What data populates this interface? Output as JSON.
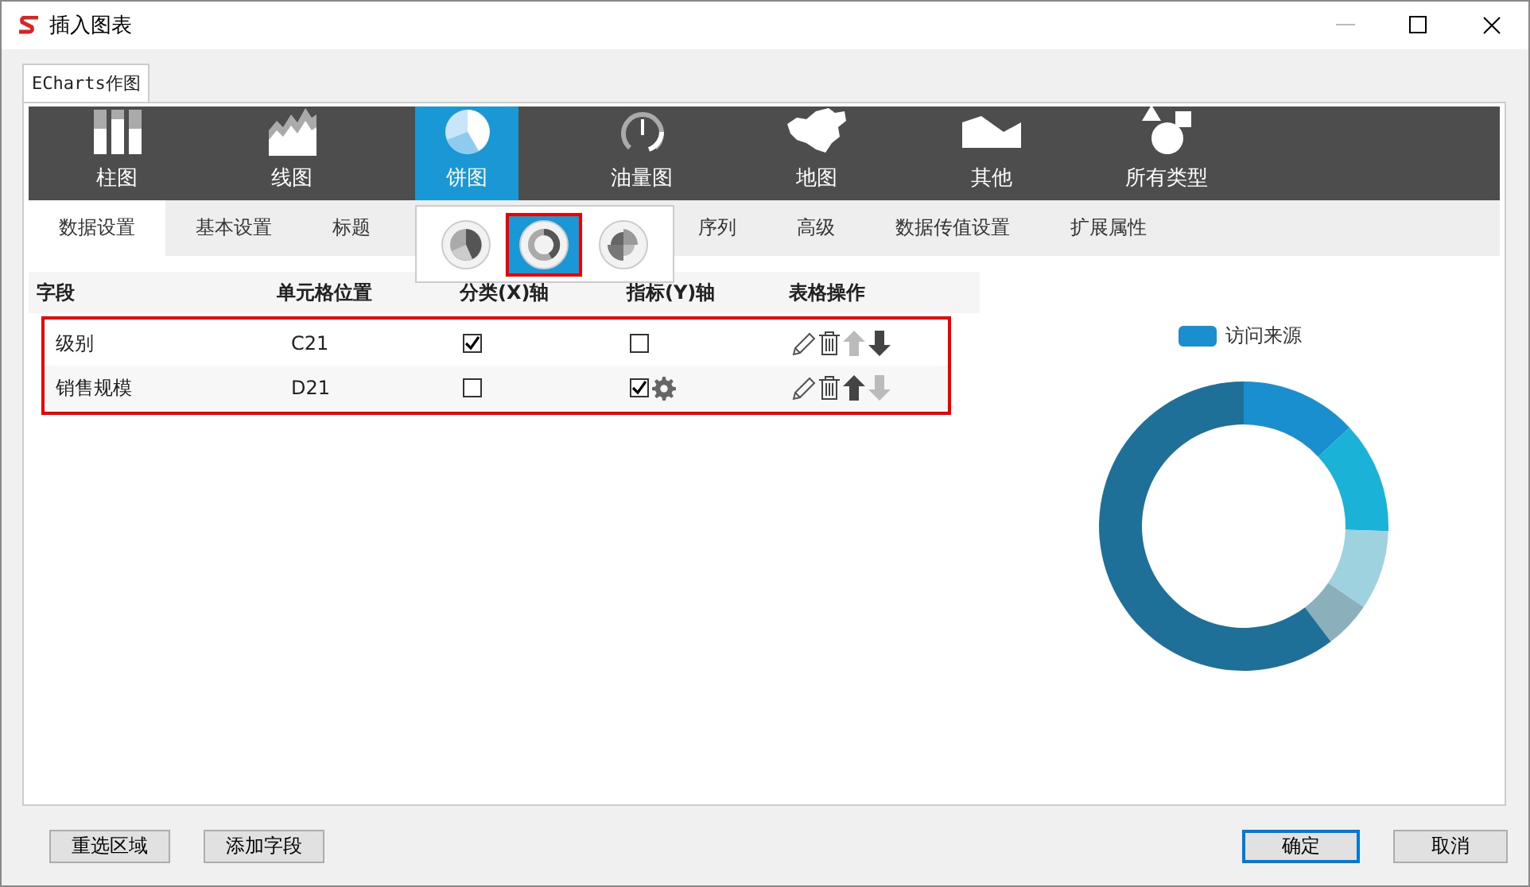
{
  "window": {
    "title": "插入图表"
  },
  "outer_tab": {
    "label": "ECharts作图",
    "selected": true
  },
  "chart_types": [
    {
      "kind": "bar",
      "label": "柱图",
      "selected": false
    },
    {
      "kind": "area",
      "label": "线图",
      "selected": false
    },
    {
      "kind": "pie",
      "label": "饼图",
      "selected": true
    },
    {
      "kind": "gauge",
      "label": "油量图",
      "selected": false
    },
    {
      "kind": "map",
      "label": "地图",
      "selected": false
    },
    {
      "kind": "other",
      "label": "其他",
      "selected": false
    },
    {
      "kind": "all",
      "label": "所有类型",
      "selected": false
    }
  ],
  "settings_tabs": [
    {
      "label": "数据设置",
      "selected": true
    },
    {
      "label": "基本设置",
      "selected": false
    },
    {
      "label": "标题",
      "selected": false
    },
    {
      "label": "序列",
      "selected": false
    },
    {
      "label": "高级",
      "selected": false
    },
    {
      "label": "数据传值设置",
      "selected": false
    },
    {
      "label": "扩展属性",
      "selected": false
    }
  ],
  "pie_subtypes": [
    {
      "kind": "pie",
      "selected": false
    },
    {
      "kind": "donut",
      "selected": true
    },
    {
      "kind": "rose",
      "selected": false
    }
  ],
  "table": {
    "columns": [
      "字段",
      "单元格位置",
      "分类(X)轴",
      "指标(Y)轴",
      "表格操作"
    ],
    "rows": [
      {
        "field": "级别",
        "cell": "C21",
        "x_axis": true,
        "y_axis": false,
        "y_settings": false,
        "can_move_up": false,
        "can_move_down": true
      },
      {
        "field": "销售规模",
        "cell": "D21",
        "x_axis": false,
        "y_axis": true,
        "y_settings": true,
        "can_move_up": true,
        "can_move_down": false
      }
    ]
  },
  "preview": {
    "legend": {
      "label": "访问来源",
      "color": "#1a8fcf"
    }
  },
  "buttons_left": [
    "重选区域",
    "添加字段"
  ],
  "buttons_right": [
    {
      "label": "确定",
      "default": true
    },
    {
      "label": "取消",
      "default": false
    }
  ]
}
